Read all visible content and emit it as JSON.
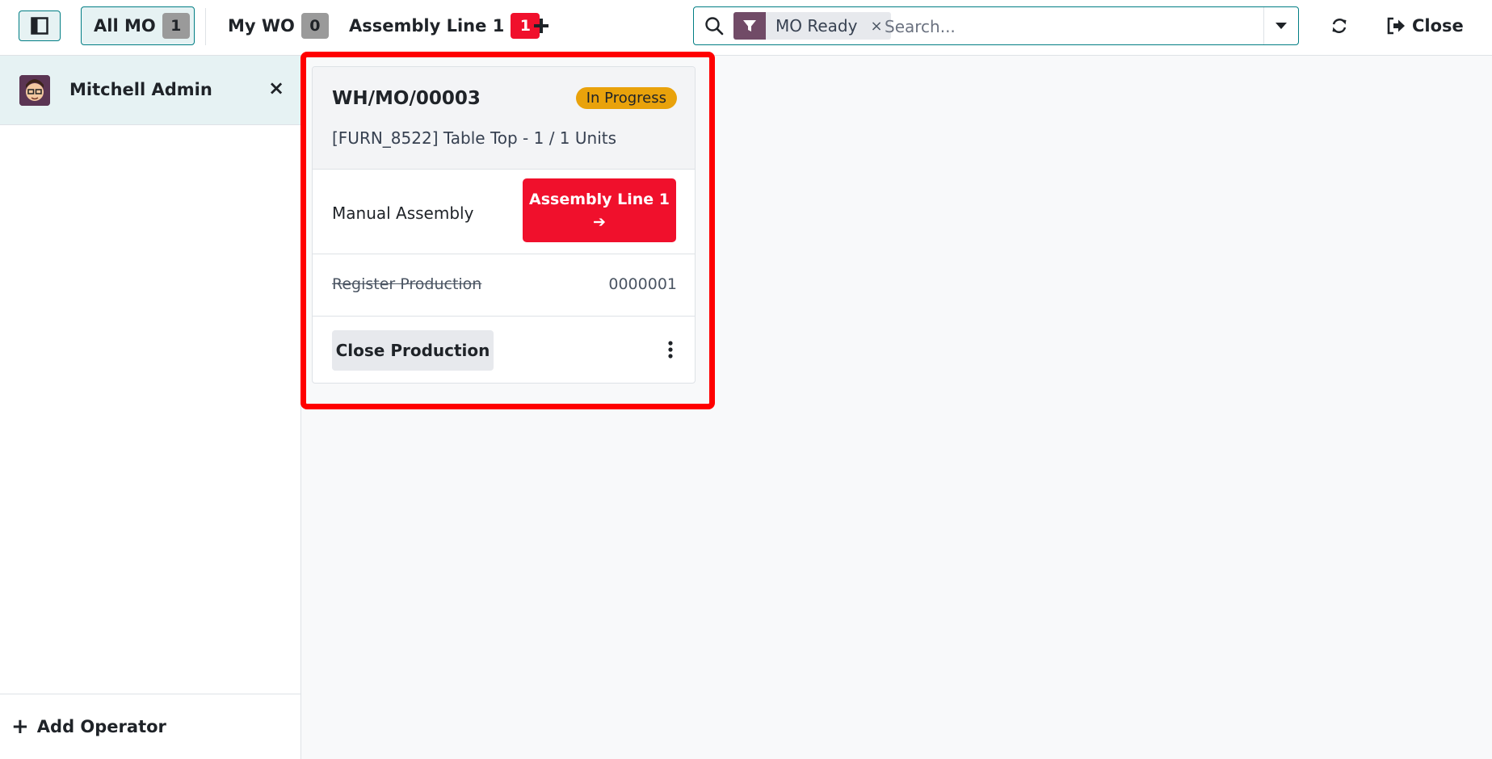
{
  "topbar": {
    "tabs": [
      {
        "label": "All MO",
        "count": "1"
      },
      {
        "label": "My WO",
        "count": "0"
      },
      {
        "label": "Assembly Line 1",
        "count": "1"
      }
    ],
    "add_tab_icon": "plus-icon",
    "search": {
      "facet_label": "MO Ready",
      "facet_remove": "×",
      "placeholder": "Search...",
      "value": ""
    },
    "refresh_icon": "refresh-icon",
    "close_label": "Close"
  },
  "operators": {
    "items": [
      {
        "name": "Mitchell Admin",
        "remove": "×"
      }
    ],
    "add_label": "Add Operator",
    "add_icon": "+"
  },
  "card": {
    "mo_name": "WH/MO/00003",
    "status": "In Progress",
    "product": "[FURN_8522] Table Top - 1 / 1 Units",
    "workorder": {
      "name": "Manual Assembly",
      "workcenter_label": "Assembly Line 1",
      "workcenter_arrow": "➔"
    },
    "step": {
      "name": "Register Production",
      "value": "0000001"
    },
    "close_label": "Close Production"
  },
  "colors": {
    "accent": "#017e84",
    "brand": "#714b67",
    "danger": "#f0102c",
    "warning": "#e9a20b",
    "highlight": "#ff0000"
  }
}
